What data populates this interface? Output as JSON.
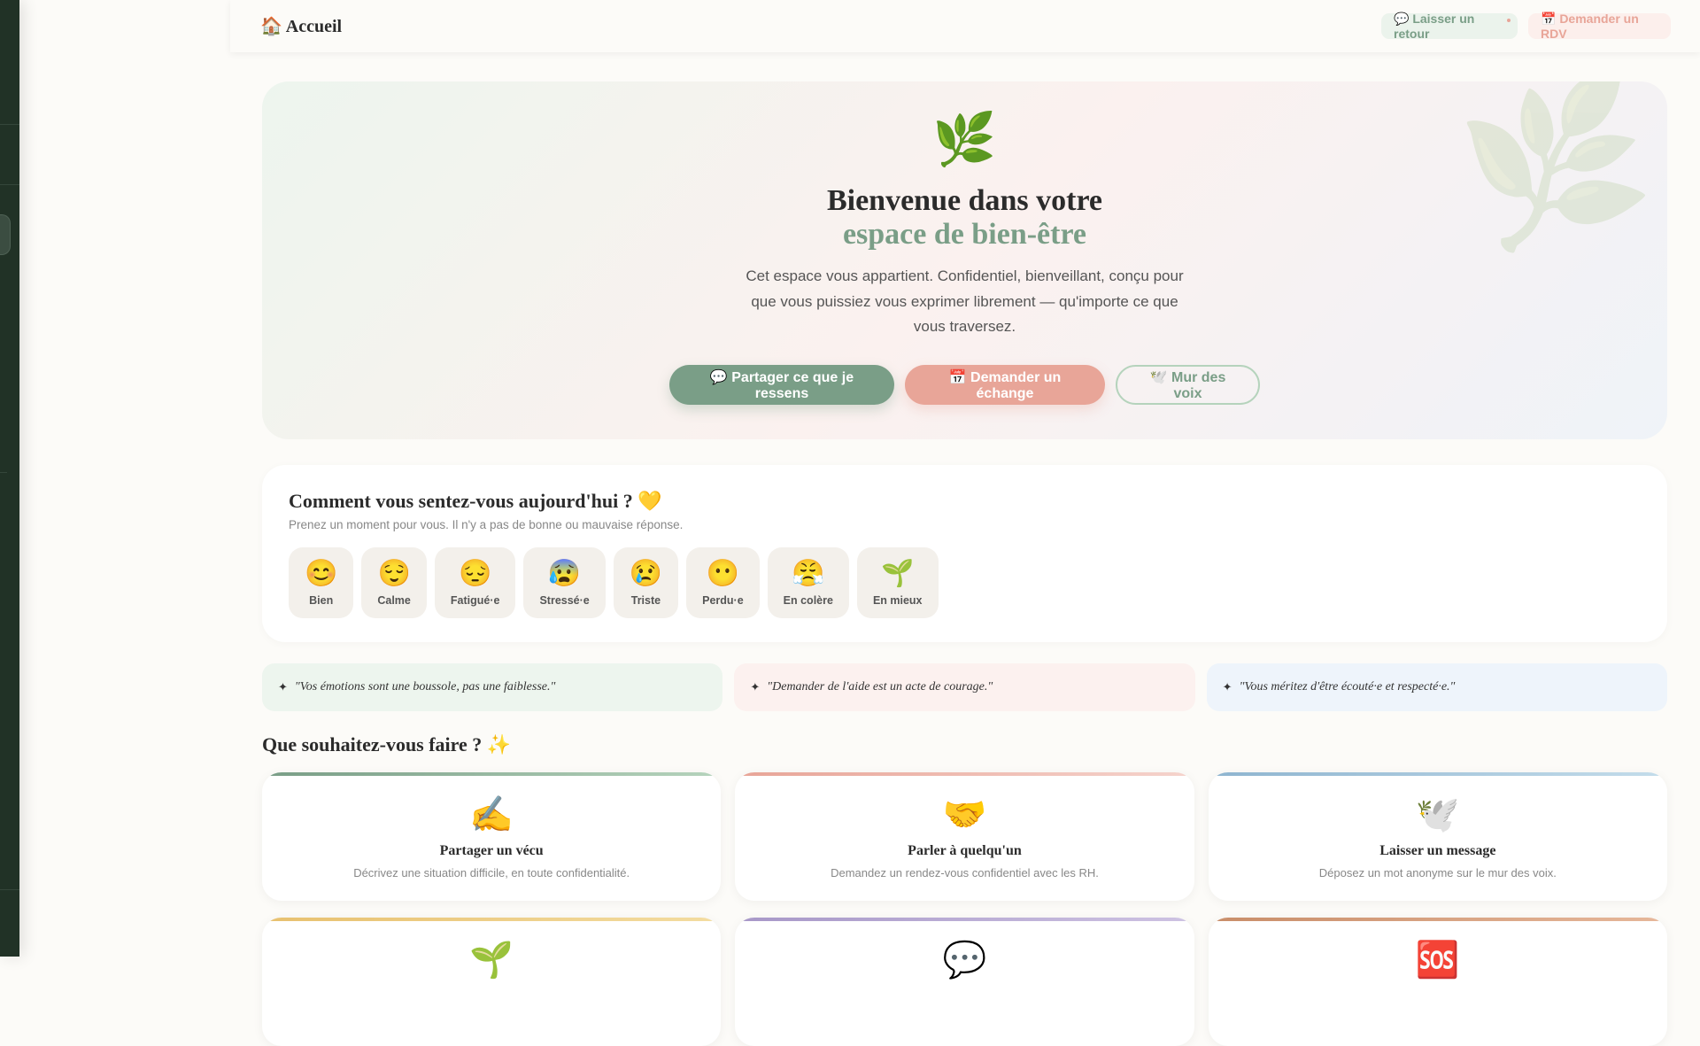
{
  "header": {
    "icon": "home-icon",
    "title": "🏠 Accueil",
    "feedback_button": "💬 Laisser un retour",
    "rdv_button": "📅 Demander un RDV"
  },
  "hero": {
    "emoji": "🌿",
    "title_line1": "Bienvenue dans votre",
    "title_line2": "espace de bien-être",
    "description": "Cet espace vous appartient. Confidentiel, bienveillant, conçu pour que vous puissiez vous exprimer librement — qu'importe ce que vous traversez.",
    "buttons": [
      "💬 Partager ce que je ressens",
      "📅 Demander un échange",
      "🕊️ Mur des voix"
    ]
  },
  "mood": {
    "title": "Comment vous sentez-vous aujourd'hui ? 💛",
    "subtitle": "Prenez un moment pour vous. Il n'y a pas de bonne ou mauvaise réponse.",
    "options": [
      {
        "emoji": "😊",
        "label": "Bien"
      },
      {
        "emoji": "😌",
        "label": "Calme"
      },
      {
        "emoji": "😔",
        "label": "Fatigué·e"
      },
      {
        "emoji": "😰",
        "label": "Stressé·e"
      },
      {
        "emoji": "😢",
        "label": "Triste"
      },
      {
        "emoji": "😶",
        "label": "Perdu·e"
      },
      {
        "emoji": "😤",
        "label": "En colère"
      },
      {
        "emoji": "🌱",
        "label": "En mieux"
      }
    ]
  },
  "quotes": [
    {
      "star": "✦",
      "text": "\"Vos émotions sont une boussole, pas une faiblesse.\"",
      "bg": "#edf5ee"
    },
    {
      "star": "✦",
      "text": "\"Demander de l'aide est un acte de courage.\"",
      "bg": "#fcf1ef"
    },
    {
      "star": "✦",
      "text": "\"Vous méritez d'être écouté·e et respecté·e.\"",
      "bg": "#eef4fb"
    }
  ],
  "actions": {
    "title": "Que souhaitez-vous faire ? ✨",
    "cards": [
      {
        "emoji": "✍️",
        "title": "Partager un vécu",
        "desc": "Décrivez une situation difficile, en toute confidentialité.",
        "gradient": [
          "#7a9e87",
          "#b5d3bc"
        ]
      },
      {
        "emoji": "🤝",
        "title": "Parler à quelqu'un",
        "desc": "Demandez un rendez-vous confidentiel avec les RH.",
        "gradient": [
          "#e8a598",
          "#f5d3cc"
        ]
      },
      {
        "emoji": "🕊️",
        "title": "Laisser un message",
        "desc": "Déposez un mot anonyme sur le mur des voix.",
        "gradient": [
          "#8fb5d0",
          "#c3dcea"
        ]
      },
      {
        "emoji": "🌱",
        "gradient": [
          "#e8c170",
          "#f3dca0"
        ]
      },
      {
        "emoji": "💬",
        "gradient": [
          "#a898c8",
          "#cdc2e2"
        ]
      },
      {
        "emoji": "🆘",
        "gradient": [
          "#c98e6a",
          "#e6b79a"
        ]
      }
    ]
  }
}
